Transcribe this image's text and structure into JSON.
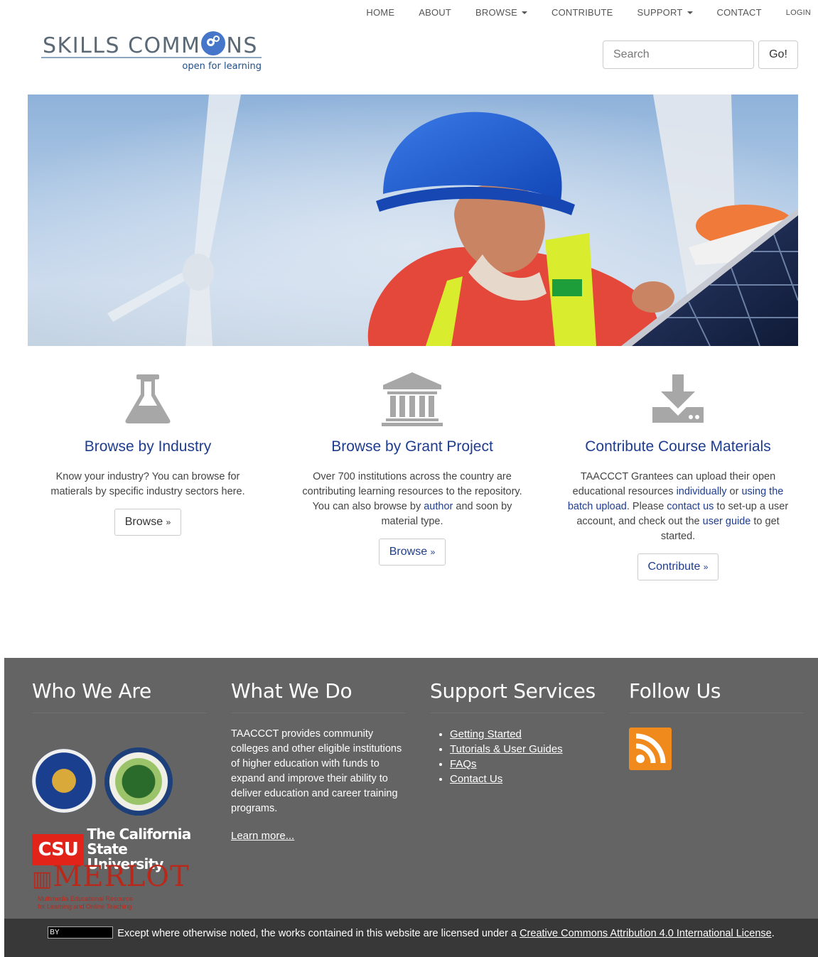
{
  "nav": {
    "items": [
      {
        "label": "HOME",
        "dropdown": false
      },
      {
        "label": "ABOUT",
        "dropdown": false
      },
      {
        "label": "BROWSE",
        "dropdown": true
      },
      {
        "label": "CONTRIBUTE",
        "dropdown": false
      },
      {
        "label": "SUPPORT",
        "dropdown": true
      },
      {
        "label": "CONTACT",
        "dropdown": false
      },
      {
        "label": "LOGIN",
        "dropdown": false
      }
    ]
  },
  "logo": {
    "text_before": "SKILLS COMM",
    "text_after": "NS",
    "tagline": "open for learning"
  },
  "search": {
    "placeholder": "Search",
    "button": "Go!"
  },
  "features": [
    {
      "icon": "flask-icon",
      "title": "Browse by Industry",
      "body": "Know your industry? You can browse for matierals by specific industry sectors here.",
      "button": "Browse"
    },
    {
      "icon": "institution-icon",
      "title": "Browse by Grant Project",
      "body_start": "Over 700 institutions across the country are contributing learning resources to the repository. You can also browse by ",
      "body_link": "author",
      "body_end": " and soon by material type.",
      "button": "Browse"
    },
    {
      "icon": "download-icon",
      "title": "Contribute Course Materials",
      "body_1": "TAACCCT Grantees can upload their open educational resources ",
      "link_1": "individually",
      "body_2": " or ",
      "link_2": "using the batch upload",
      "body_3": ". Please ",
      "link_3": "contact us",
      "body_4": " to set-up a user account, and check out the ",
      "link_4": "user guide",
      "body_5": " to get started.",
      "button": "Contribute"
    }
  ],
  "footer": {
    "who": {
      "title": "Who We Are",
      "csu_abbr": "CSU",
      "csu_line1": "The California",
      "csu_line2": "State University",
      "merlot": "MERLOT",
      "merlot_sub1": "Multimedia Educational Resource",
      "merlot_sub2": "for Learning and Online Teaching"
    },
    "what": {
      "title": "What We Do",
      "body": "TAACCCT provides community colleges and other eligible institutions of higher education with funds to expand and improve their ability to deliver education and career training programs.",
      "link": "Learn more..."
    },
    "support": {
      "title": "Support Services",
      "links": [
        "Getting Started",
        "Tutorials & User Guides",
        "FAQs",
        "Contact Us"
      ]
    },
    "follow": {
      "title": "Follow Us",
      "icon": "rss-icon"
    }
  },
  "license": {
    "badge": "BY",
    "text": "Except where otherwise noted, the works contained in this website are licensed under a ",
    "link": "Creative Commons Attribution 4.0 International License",
    "end": "."
  }
}
